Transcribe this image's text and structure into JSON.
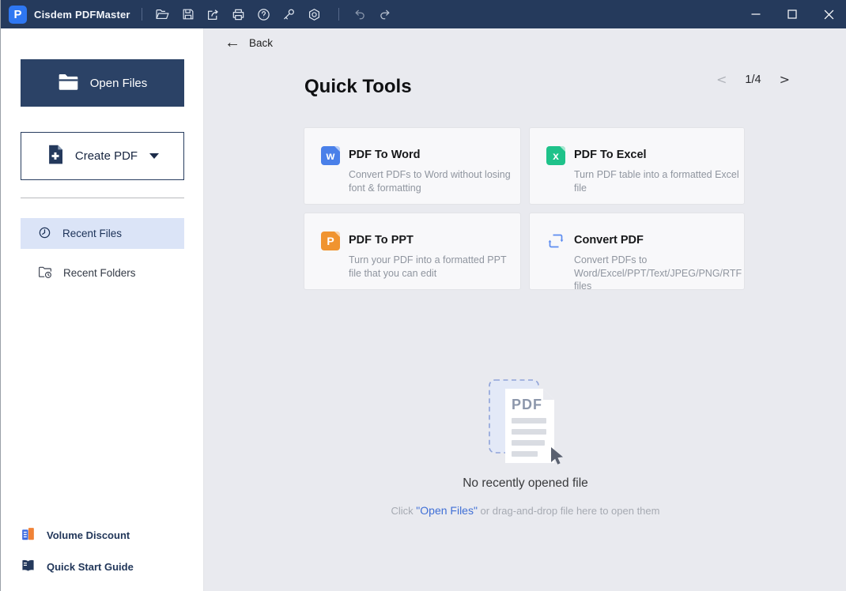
{
  "titlebar": {
    "app_title": "Cisdem PDFMaster",
    "toolbar_icons": [
      "open-file-icon",
      "save-icon",
      "share-icon",
      "print-icon",
      "help-icon",
      "register-key-icon",
      "settings-icon",
      "undo-icon",
      "redo-icon"
    ],
    "window_controls": [
      "minimize",
      "maximize",
      "close"
    ]
  },
  "sidebar": {
    "open_files_label": "Open Files",
    "create_pdf_label": "Create PDF",
    "items": [
      {
        "label": "Recent Files",
        "icon": "clock-icon",
        "selected": true
      },
      {
        "label": "Recent Folders",
        "icon": "folder-clock-icon",
        "selected": false
      }
    ],
    "footer_items": [
      {
        "label": "Volume Discount",
        "icon": "buildings-icon"
      },
      {
        "label": "Quick Start Guide",
        "icon": "book-icon"
      }
    ]
  },
  "main": {
    "back_label": "Back",
    "title": "Quick Tools",
    "pagination": {
      "current": "1/4",
      "prev": "<",
      "next": ">"
    },
    "cards": [
      {
        "title": "PDF To Word",
        "desc": "Convert PDFs to Word without losing font & formatting",
        "icon": "word-icon",
        "letter": "w",
        "color": "#4a80e9"
      },
      {
        "title": "PDF To Excel",
        "desc": "Turn PDF table into a formatted Excel file",
        "icon": "excel-icon",
        "letter": "x",
        "color": "#1fc28a"
      },
      {
        "title": "PDF To PPT",
        "desc": "Turn your PDF into a formatted PPT file that you can edit",
        "icon": "ppt-icon",
        "letter": "P",
        "color": "#f0942f"
      },
      {
        "title": "Convert PDF",
        "desc": "Convert PDFs to Word/Excel/PPT/Text/JPEG/PNG/RTF files",
        "icon": "convert-icon",
        "color": "#5c8cf0"
      }
    ],
    "empty_state": {
      "illustration_label": "PDF",
      "title": "No recently opened file",
      "hint_prefix": "Click ",
      "hint_link": "\"Open Files\"",
      "hint_suffix": " or drag-and-drop file here to open them"
    }
  },
  "colors": {
    "titlebar_bg": "#253a5c",
    "accent_navy": "#2b4266",
    "selected_item_bg": "#dbe4f7",
    "main_bg": "#e9eaef",
    "link_blue": "#3f6fd6"
  }
}
